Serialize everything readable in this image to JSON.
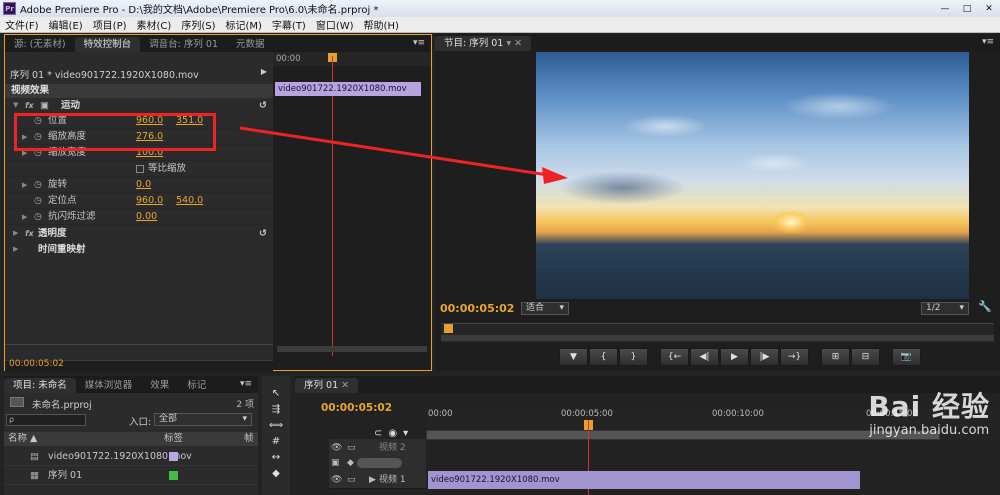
{
  "window": {
    "title": "Adobe Premiere Pro - D:\\我的文档\\Adobe\\Premiere Pro\\6.0\\未命名.prproj *",
    "app_badge": "Pr"
  },
  "menu": [
    "文件(F)",
    "编辑(E)",
    "项目(P)",
    "素材(C)",
    "序列(S)",
    "标记(M)",
    "字幕(T)",
    "窗口(W)",
    "帮助(H)"
  ],
  "effect_panel": {
    "tabs": [
      "源: (无素材)",
      "特效控制台",
      "调音台: 序列 01",
      "元数据"
    ],
    "active_tab": "特效控制台",
    "seq_label": "序列 01 * video901722.1920X1080.mov",
    "video_effects_label": "视频效果",
    "motion_label": "运动",
    "props": [
      {
        "label": "位置",
        "v1": "960.0",
        "v2": "351.0"
      },
      {
        "label": "缩放高度",
        "v1": "276.0",
        "v2": ""
      },
      {
        "label": "缩放宽度",
        "v1": "100.0",
        "v2": ""
      },
      {
        "label": "等比缩放",
        "v1": "",
        "v2": ""
      },
      {
        "label": "旋转",
        "v1": "0.0",
        "v2": ""
      },
      {
        "label": "定位点",
        "v1": "960.0",
        "v2": "540.0"
      },
      {
        "label": "抗闪烁过滤",
        "v1": "0.00",
        "v2": ""
      }
    ],
    "opacity_label": "透明度",
    "time_remap_label": "时间重映射",
    "ruler_time": "00:00",
    "clip_name": "video901722.1920X1080.mov",
    "current_time": "00:00:05:02"
  },
  "program_panel": {
    "tab": "节目: 序列 01",
    "current_time": "00:00:05:02",
    "fit_label": "适合",
    "quality_label": "1/2",
    "transport": [
      "▼",
      "{",
      "}",
      "{←",
      "◀|",
      "▶",
      "|▶",
      "→}",
      "⊞",
      "⊟",
      "📷"
    ]
  },
  "project_panel": {
    "tabs": [
      "项目: 未命名",
      "媒体浏览器",
      "效果",
      "标记"
    ],
    "project_file": "未命名.prproj",
    "count": "2 项",
    "search_placeholder": "ρ",
    "inpoint_label": "入口:",
    "inpoint_value": "全部",
    "col_name": "名称",
    "col_label": "标签",
    "col_frame": "帧",
    "items": [
      {
        "name": "video901722.1920X1080.mov",
        "color": "#b9a7e6"
      },
      {
        "name": "序列 01",
        "color": "#44bb44"
      }
    ]
  },
  "tools": [
    "selection-tool",
    "track-select-tool",
    "ripple-edit-tool",
    "rolling-edit-tool",
    "rate-stretch-tool",
    "razor-tool"
  ],
  "timeline": {
    "tab": "序列 01",
    "current_time": "00:00:05:02",
    "ticks": [
      "00:00",
      "00:00:05:00",
      "00:00:10:00",
      "00:00:15:00"
    ],
    "tracks": [
      {
        "name": "视频 2"
      },
      {
        "name": ""
      },
      {
        "name": "视频 1"
      }
    ],
    "clip_name": "video901722.1920X1080.mov"
  },
  "watermark": {
    "brand": "Bai 经验",
    "url": "jingyan.baidu.com"
  }
}
